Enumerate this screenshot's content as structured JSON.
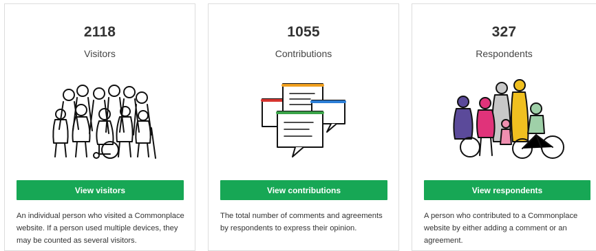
{
  "cards": [
    {
      "count": "2118",
      "label": "Visitors",
      "button_label": "View visitors",
      "description": "An individual person who visited a Commonplace website. If a person used multiple devices, they may be counted as several visitors.",
      "icon": "crowd-illustration"
    },
    {
      "count": "1055",
      "label": "Contributions",
      "button_label": "View contributions",
      "description": "The total number of comments and agreements by respondents to express their opinion.",
      "icon": "comment-windows-illustration"
    },
    {
      "count": "327",
      "label": "Respondents",
      "button_label": "View respondents",
      "description": "A person who contributed to a Commonplace website by either adding a comment or an agreement.",
      "icon": "colored-people-illustration"
    }
  ],
  "colors": {
    "button": "#17a755",
    "button_text": "#ffffff",
    "card_border": "#dcdcdc"
  }
}
